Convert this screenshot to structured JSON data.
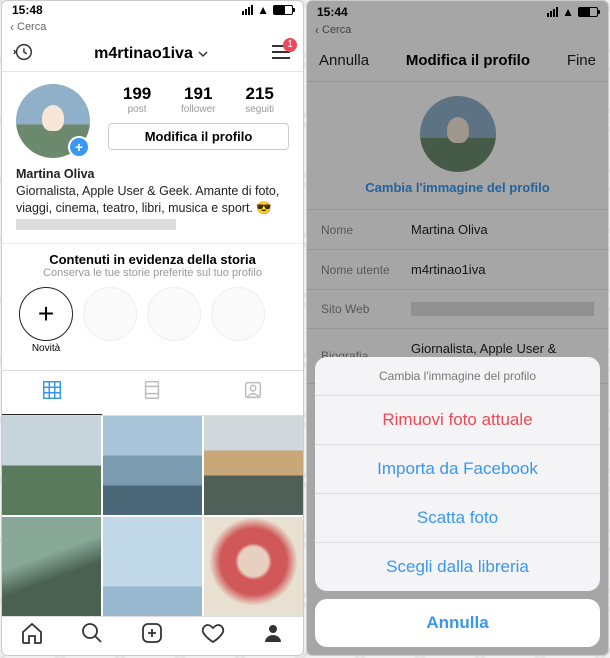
{
  "left": {
    "status": {
      "time": "15:48",
      "back": "Cerca"
    },
    "header": {
      "username": "m4rtinao1iva",
      "badge": "1"
    },
    "stats": {
      "posts": {
        "n": "199",
        "l": "post"
      },
      "followers": {
        "n": "191",
        "l": "follower"
      },
      "following": {
        "n": "215",
        "l": "seguiti"
      }
    },
    "edit_button": "Modifica il profilo",
    "bio": {
      "name": "Martina Oliva",
      "text": "Giornalista, Apple User & Geek. Amante di foto, viaggi, cinema, teatro, libri, musica e sport. 😎"
    },
    "highlights": {
      "title": "Contenuti in evidenza della storia",
      "subtitle": "Conserva le tue storie preferite sul tuo profilo",
      "add_label": "Novità"
    }
  },
  "right": {
    "status": {
      "time": "15:44",
      "back": "Cerca"
    },
    "header": {
      "cancel": "Annulla",
      "title": "Modifica il profilo",
      "done": "Fine"
    },
    "change_link": "Cambia l'immagine del profilo",
    "fields": {
      "name": {
        "label": "Nome",
        "value": "Martina Oliva"
      },
      "username": {
        "label": "Nome utente",
        "value": "m4rtinao1iva"
      },
      "website": {
        "label": "Sito Web",
        "value": ""
      },
      "bio": {
        "label": "Biografia",
        "value": "Giornalista, Apple User & Geek."
      }
    },
    "sheet": {
      "title": "Cambia l'immagine del profilo",
      "remove": "Rimuovi foto attuale",
      "facebook": "Importa da Facebook",
      "camera": "Scatta foto",
      "library": "Scegli dalla libreria",
      "cancel": "Annulla"
    }
  }
}
